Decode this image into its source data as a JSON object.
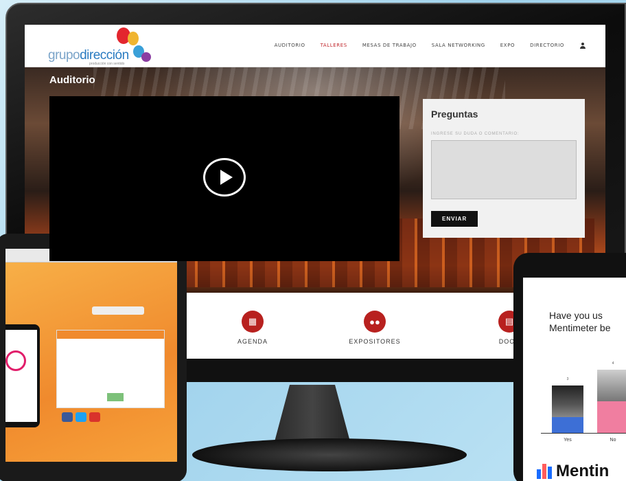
{
  "site": {
    "logo_prefix": "grupo",
    "logo_suffix": "dirección",
    "logo_tagline": "producción con sentido",
    "nav": [
      "AUDITORIO",
      "TALLERES",
      "MESAS DE TRABAJO",
      "SALA NETWORKING",
      "EXPO",
      "DIRECTORIO"
    ],
    "active_nav": "TALLERES"
  },
  "auditorio": {
    "title": "Auditorio",
    "questions_title": "Preguntas",
    "questions_placeholder_label": "INGRESE SU DUDA O COMENTARIO:",
    "send_button": "ENVIAR"
  },
  "features": [
    {
      "label": "AGENDA",
      "icon": "calendar-icon"
    },
    {
      "label": "EXPOSITORES",
      "icon": "people-icon"
    },
    {
      "label": "DOCU",
      "icon": "document-icon"
    }
  ],
  "mentimeter": {
    "question_line1": "Have you us",
    "question_line2": "Mentimeter be",
    "brand": "Mentin",
    "bars": [
      {
        "label": "Yes",
        "count": "3",
        "color": "#3d6fd6",
        "height_fraction": 0.75
      },
      {
        "label": "No",
        "count": "4",
        "color": "#f07ea0",
        "height_fraction": 1.0
      }
    ]
  },
  "colors": {
    "accent_red": "#b8211f",
    "nav_active": "#c0282d",
    "tablet_orange": "#f08a2d"
  }
}
